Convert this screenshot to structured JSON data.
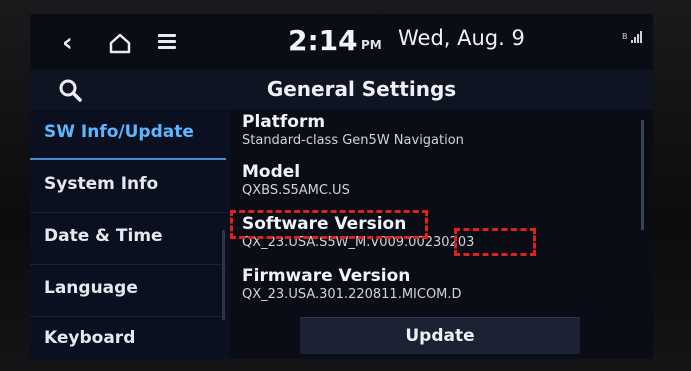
{
  "status_bar": {
    "time": "2:14",
    "ampm": "PM",
    "date": "Wed, Aug. 9",
    "signal_icon": "signal-strength-icon"
  },
  "header": {
    "title": "General Settings",
    "search_icon": "search-icon"
  },
  "nav": {
    "back_icon": "back-chevron-icon",
    "home_icon": "home-icon",
    "menu_icon": "menu-icon"
  },
  "sidebar": {
    "items": [
      {
        "label": "SW Info/Update",
        "active": true
      },
      {
        "label": "System Info",
        "active": false
      },
      {
        "label": "Date & Time",
        "active": false
      },
      {
        "label": "Language",
        "active": false
      },
      {
        "label": "Keyboard",
        "active": false
      }
    ]
  },
  "main": {
    "settings": [
      {
        "name": "Platform",
        "value": "Standard-class Gen5W Navigation"
      },
      {
        "name": "Model",
        "value": "QXBS.S5AMC.US"
      },
      {
        "name": "Software Version",
        "value": "QX_23.USA.S5W_M.V009.00",
        "value_highlight": "230203"
      },
      {
        "name": "Firmware Version",
        "value": "QX_23.USA.301.220811.MICOM.D"
      }
    ],
    "update_button": "Update"
  },
  "colors": {
    "accent": "#5db6ff",
    "highlight_box": "#e0201a",
    "background": "#0a0d16"
  }
}
